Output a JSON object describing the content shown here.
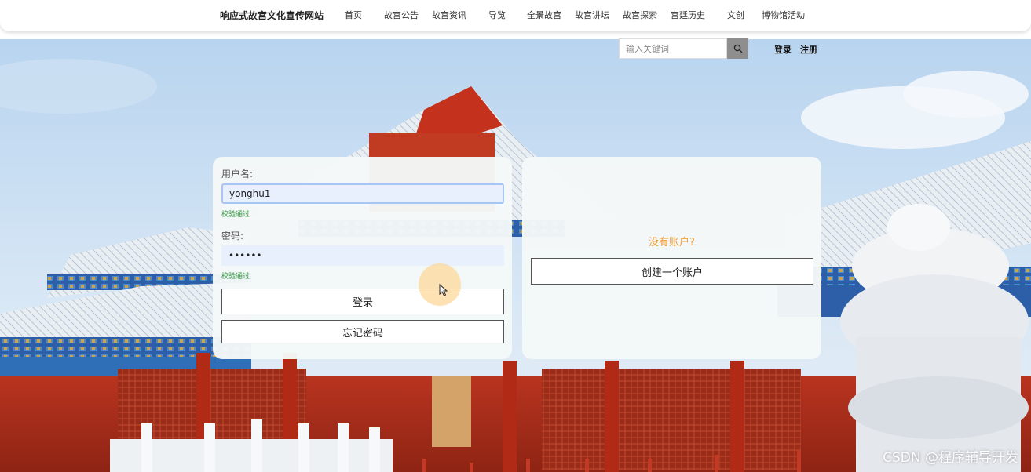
{
  "nav": {
    "site_title": "响应式故宫文化宣传网站",
    "items": [
      "首页",
      "故宫公告",
      "故宫资讯",
      "导览",
      "全景故宫",
      "故宫讲坛",
      "故宫探索",
      "宫廷历史",
      "文创",
      "博物馆活动"
    ]
  },
  "search": {
    "placeholder": "输入关键词",
    "icon": "search-icon"
  },
  "auth": {
    "login": "登录",
    "register": "注册"
  },
  "login_form": {
    "username_label": "用户名:",
    "username_value": "yonghu1",
    "username_status": "校验通过",
    "password_label": "密码:",
    "password_value": "••••••",
    "password_status": "校验通过",
    "login_button": "登录",
    "forgot_button": "忘记密码"
  },
  "signup_box": {
    "prompt": "没有账户?",
    "create_button": "创建一个账户"
  },
  "watermark": "CSDN @程序辅导开发",
  "colors": {
    "valid": "#2e9a3a",
    "prompt": "#f0a030",
    "search_button": "#8e8e8e"
  }
}
